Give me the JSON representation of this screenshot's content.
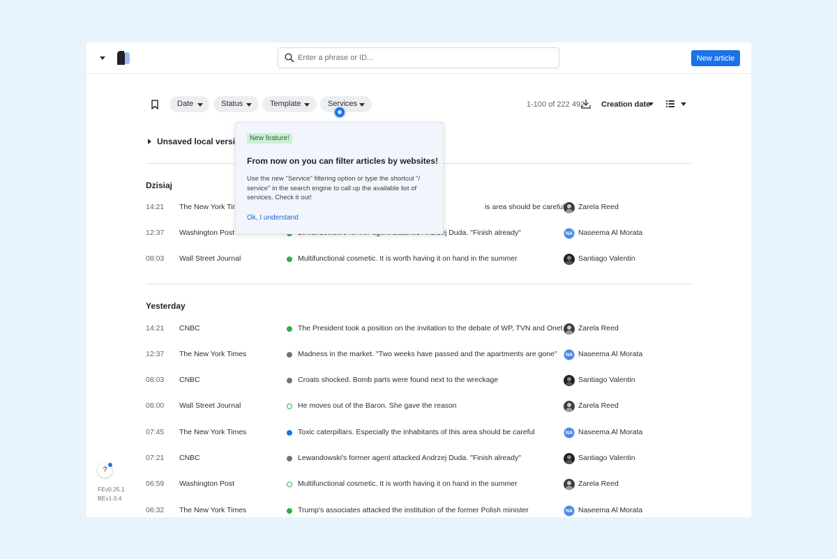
{
  "header": {
    "search_placeholder": "Enter a phrase or ID...",
    "new_article_label": "New article"
  },
  "filters": {
    "chips": [
      "Date",
      "Status",
      "Template",
      "Services"
    ],
    "count": "1-100 of 222 492",
    "sort_label": "Creation date"
  },
  "unsaved_label": "Unsaved local version",
  "popover": {
    "badge": "New feature!",
    "title": "From now on you can filter articles by websites!",
    "body": "Use the new \"Service\" filtering option or type the shortcut \"/ service\" in the search engine to call up the available list of services. Check it out!",
    "link": "Ok, I understand"
  },
  "groups": [
    {
      "title": "Dzisiaj",
      "rows": [
        {
          "time": "14:21",
          "source": "The New York Times",
          "status": "published",
          "title": "is area should be careful",
          "author": "Zarela Reed",
          "avatar": "photo",
          "initials": ""
        },
        {
          "time": "12:37",
          "source": "Washington Post",
          "status": "published",
          "title": "Lewandowski's former agent attacked Andrzej Duda. \"Finish already\"",
          "author": "Naseema Al Morata",
          "avatar": "initials",
          "initials": "NA"
        },
        {
          "time": "08:03",
          "source": "Wall Street Journal",
          "status": "published",
          "title": "Multifunctional cosmetic. It is worth having it on hand in the summer",
          "author": "Santiago Valentin",
          "avatar": "photo-dark",
          "initials": ""
        }
      ]
    },
    {
      "title": "Yesterday",
      "rows": [
        {
          "time": "14:21",
          "source": "CNBC",
          "status": "published",
          "title": "The President took a position on the invitation to the debate of WP, TVN and Onet",
          "author": "Zarela Reed",
          "avatar": "photo",
          "initials": ""
        },
        {
          "time": "12:37",
          "source": "The New York Times",
          "status": "draft",
          "title": "Madness in the market. \"Two weeks have passed and the apartments are gone\"",
          "author": "Naseema Al Morata",
          "avatar": "initials",
          "initials": "NA"
        },
        {
          "time": "08:03",
          "source": "CNBC",
          "status": "draft",
          "title": "Croats shocked. Bomb parts were found next to the wreckage",
          "author": "Santiago Valentin",
          "avatar": "photo-dark",
          "initials": ""
        },
        {
          "time": "08:00",
          "source": "Wall Street Journal",
          "status": "scheduled",
          "title": "He moves out of the Baron. She gave the reason",
          "author": "Zarela Reed",
          "avatar": "photo",
          "initials": ""
        },
        {
          "time": "07:45",
          "source": "The New York Times",
          "status": "review",
          "title": "Toxic caterpillars. Especially the inhabitants of this area should be careful",
          "author": "Naseema Al Morata",
          "avatar": "initials",
          "initials": "NA"
        },
        {
          "time": "07:21",
          "source": "CNBC",
          "status": "draft",
          "title": "Lewandowski's former agent attacked Andrzej Duda. \"Finish already\"",
          "author": "Santiago Valentin",
          "avatar": "photo-dark",
          "initials": ""
        },
        {
          "time": "06:59",
          "source": "Washington Post",
          "status": "scheduled",
          "title": "Multifunctional cosmetic. It is worth having it on hand in the summer",
          "author": "Zarela Reed",
          "avatar": "photo",
          "initials": ""
        },
        {
          "time": "06:32",
          "source": "The New York Times",
          "status": "published",
          "title": "Trump's associates attacked the institution of the former Polish minister",
          "author": "Naseema Al Morata",
          "avatar": "initials",
          "initials": "NA"
        }
      ]
    }
  ],
  "status_colors": {
    "published": "#2fae4e",
    "draft": "#6f7378",
    "review": "#1a73e8",
    "scheduled": "#2fae4e"
  },
  "help_label": "?",
  "versions": {
    "fe": "FEv0.25.1",
    "be": "BEv1.0.4"
  }
}
